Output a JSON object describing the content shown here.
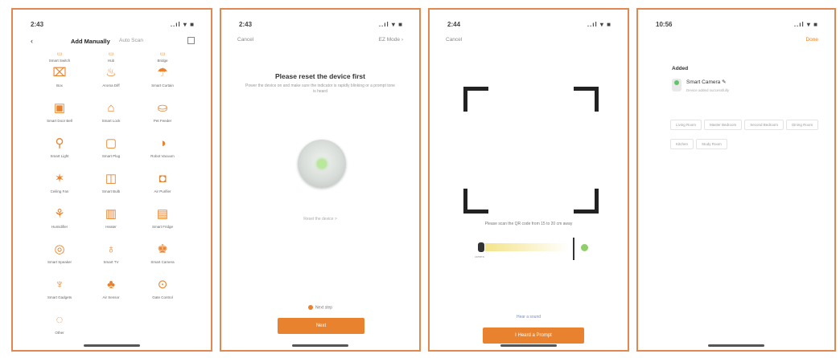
{
  "colors": {
    "accent": "#e8822e",
    "frame": "#e08850",
    "link": "#6b8fd1",
    "online": "#5fc46b"
  },
  "panel1": {
    "status": {
      "time": "2:43",
      "signal": "..ıl ▾ ■"
    },
    "nav": {
      "back": "‹",
      "tab_active": "Add Manually",
      "tab_inactive": "Auto Scan"
    },
    "devices": [
      {
        "icon": "▭",
        "label": "Smart Switch"
      },
      {
        "icon": "▭",
        "label": "Hub"
      },
      {
        "icon": "▭",
        "label": "Bridge"
      },
      {
        "icon": "⌧",
        "label": "Box"
      },
      {
        "icon": "♨",
        "label": "Aroma Diff"
      },
      {
        "icon": "☂",
        "label": "Smart Curtain"
      },
      {
        "icon": "▣",
        "label": "Smart Door Bell"
      },
      {
        "icon": "⌂",
        "label": "Smart Lock"
      },
      {
        "icon": "⛀",
        "label": "Pet Feeder"
      },
      {
        "icon": "⚲",
        "label": "Smart Light"
      },
      {
        "icon": "▢",
        "label": "Smart Plug"
      },
      {
        "icon": "◑",
        "label": "Robot Vacuum"
      },
      {
        "icon": "✶",
        "label": "Ceiling Fan"
      },
      {
        "icon": "◫",
        "label": "Smart Bulb"
      },
      {
        "icon": "◘",
        "label": "Air Purifier"
      },
      {
        "icon": "⚘",
        "label": "Humidifier"
      },
      {
        "icon": "▥",
        "label": "Heater"
      },
      {
        "icon": "▤",
        "label": "Smart Fridge"
      },
      {
        "icon": "◎",
        "label": "Smart Speaker"
      },
      {
        "icon": "♁",
        "label": "Smart TV"
      },
      {
        "icon": "♚",
        "label": "Smart Camera"
      },
      {
        "icon": "♆",
        "label": "Smart Gadgets"
      },
      {
        "icon": "♣",
        "label": "Air Sensor"
      },
      {
        "icon": "⊙",
        "label": "Gate Control"
      },
      {
        "icon": "◌",
        "label": "Other"
      }
    ]
  },
  "panel2": {
    "status": {
      "time": "2:43",
      "signal": "..ıl ▾ ■"
    },
    "topbar": {
      "left": "Cancel",
      "right": "EZ Mode ›"
    },
    "title": "Please reset the device first",
    "description": "Power the device on and make sure the indicator is rapidly blinking or a prompt tone is heard",
    "hint": "Reset the device >",
    "confirm": "Next step",
    "button": "Next"
  },
  "panel3": {
    "status": {
      "time": "2:44",
      "signal": "..ıl ▾ ■"
    },
    "topbar": {
      "left": "Cancel"
    },
    "hint": "Please scan the QR code from 15 to 20 cm away",
    "illus_caption": "camera",
    "link": "Hear a sound",
    "button": "I Heard a Prompt"
  },
  "panel4": {
    "status": {
      "time": "10:56",
      "signal": "..ıl ▾ ■"
    },
    "topbar": {
      "right": "Done"
    },
    "section": "Added",
    "device_name": "Smart Camera ✎",
    "device_sub": "Device added successfully",
    "rooms": [
      "Living Room",
      "Master Bedroom",
      "Second Bedroom",
      "Dining Room",
      "Kitchen",
      "Study Room"
    ]
  }
}
